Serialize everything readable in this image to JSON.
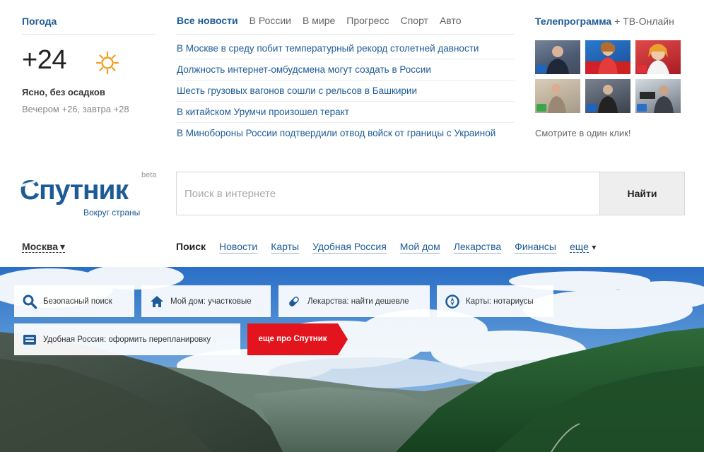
{
  "weather": {
    "title": "Погода",
    "temperature": "+24",
    "condition": "Ясно, без осадков",
    "forecast": "Вечером +26, завтра +28",
    "icon": "sun-icon"
  },
  "news": {
    "tabs": [
      {
        "label": "Все новости",
        "active": true
      },
      {
        "label": "В России"
      },
      {
        "label": "В мире"
      },
      {
        "label": "Прогресс"
      },
      {
        "label": "Спорт"
      },
      {
        "label": "Авто"
      }
    ],
    "headlines": [
      "В Москве в среду побит температурный рекорд столетней давности",
      "Должность интернет-омбудсмена могут создать в России",
      "Шесть грузовых вагонов сошли с рельсов в Башкирии",
      "В китайском Урумчи произошел теракт",
      "В Минобороны России подтвердили отвод войск от границы с Украиной"
    ]
  },
  "tv": {
    "title": "Телепрограмма",
    "online": " + ТВ-Онлайн",
    "cta": "Смотрите в один клик!",
    "thumbnails": [
      {
        "logo": "channel-1-logo",
        "color": "#1a66c2"
      },
      {
        "logo": "channel-2-logo",
        "color": "#d32030"
      },
      {
        "logo": "channel-3-logo",
        "color": "#e0303a"
      },
      {
        "logo": "channel-4-logo",
        "color": "#3aa64a"
      },
      {
        "logo": "channel-5-logo",
        "color": "#1a66c2"
      },
      {
        "logo": "channel-6-logo",
        "color": "#2a6fc9"
      }
    ]
  },
  "brand": {
    "name": "Спутник",
    "beta": "beta",
    "tagline": "Вокруг страны",
    "color": "#1d5b96"
  },
  "search": {
    "placeholder": "Поиск в интернете",
    "value": "",
    "button": "Найти"
  },
  "city": {
    "label": "Москва",
    "caret": "▾"
  },
  "nav": {
    "items": [
      {
        "label": "Поиск",
        "active": true
      },
      {
        "label": "Новости"
      },
      {
        "label": "Карты"
      },
      {
        "label": "Удобная Россия"
      },
      {
        "label": "Мой дом"
      },
      {
        "label": "Лекарства"
      },
      {
        "label": "Финансы"
      }
    ],
    "more": "еще",
    "more_caret": "▾"
  },
  "hero": {
    "tiles": [
      {
        "label": "Безопасный поиск",
        "icon": "magnifier-icon"
      },
      {
        "label": "Мой дом: участковые",
        "icon": "house-icon"
      },
      {
        "label": "Лекарства: найти дешевле",
        "icon": "pill-icon"
      },
      {
        "label": "Карты: нотариусы",
        "icon": "compass-icon"
      },
      {
        "label": "Удобная Россия: оформить перепланировку",
        "icon": "ticket-icon"
      }
    ],
    "more_button": "еще про Спутник",
    "accent": "#e3141d"
  }
}
